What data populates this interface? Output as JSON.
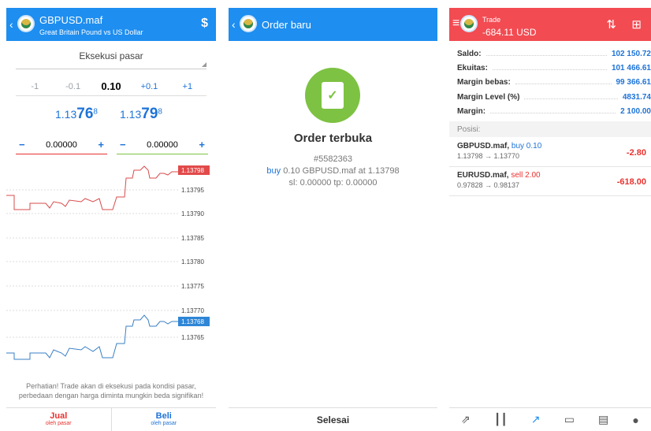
{
  "panel1": {
    "back": "‹",
    "symbol": "GBPUSD.maf",
    "description": "Great Britain Pound vs US Dollar",
    "right_icon": "$",
    "execution": "Eksekusi pasar",
    "volume": {
      "m1": "-1",
      "m01": "-0.1",
      "value": "0.10",
      "p01": "+0.1",
      "p1": "+1"
    },
    "bid": {
      "main": "1.13",
      "big": "76",
      "sup": "8"
    },
    "ask": {
      "main": "1.13",
      "big": "79",
      "sup": "8"
    },
    "sl": {
      "minus": "−",
      "value": "0.00000",
      "plus": "+"
    },
    "tp": {
      "minus": "−",
      "value": "0.00000",
      "plus": "+"
    },
    "chart_ask_label": "1.13798",
    "chart_bid_label": "1.13768",
    "ticks": [
      "1.13795",
      "1.13790",
      "1.13785",
      "1.13780",
      "1.13775",
      "1.13770",
      "1.13765"
    ],
    "warning": "Perhatian! Trade akan di eksekusi pada kondisi pasar, perbedaan dengan harga diminta mungkin beda signifikan!",
    "sell": {
      "label": "Jual",
      "sub": "oleh pasar"
    },
    "buy": {
      "label": "Beli",
      "sub": "oleh pasar"
    },
    "colors": {
      "sell": "#e8322f",
      "buy": "#1e73d8"
    }
  },
  "panel2": {
    "back": "‹",
    "title": "Order baru",
    "status": "Order terbuka",
    "ticket": "#5582363",
    "side": "buy",
    "detail": "0.10 GBPUSD.maf at 1.13798",
    "sltp": "sl: 0.00000 tp: 0.00000",
    "done": "Selesai"
  },
  "panel3": {
    "menu": "≡",
    "title": "Trade",
    "profit": "-684.11 USD",
    "rows": [
      {
        "label": "Saldo:",
        "value": "102 150.72"
      },
      {
        "label": "Ekuitas:",
        "value": "101 466.61"
      },
      {
        "label": "Margin bebas:",
        "value": "99 366.61"
      },
      {
        "label": "Margin Level (%)",
        "value": "4831.74"
      },
      {
        "label": "Margin:",
        "value": "2 100.00"
      }
    ],
    "positions_header": "Posisi:",
    "positions": [
      {
        "symbol": "GBPUSD.maf,",
        "side": "buy 0.10",
        "prices": "1.13798 → 1.13770",
        "pl": "-2.80"
      },
      {
        "symbol": "EURUSD.maf,",
        "side": "sell 2.00",
        "prices": "0.97828 → 0.98137",
        "pl": "-618.00"
      }
    ],
    "tab_icons": [
      "quotes-icon",
      "chart-icon",
      "trade-icon",
      "history-icon",
      "news-icon",
      "chat-icon"
    ]
  }
}
